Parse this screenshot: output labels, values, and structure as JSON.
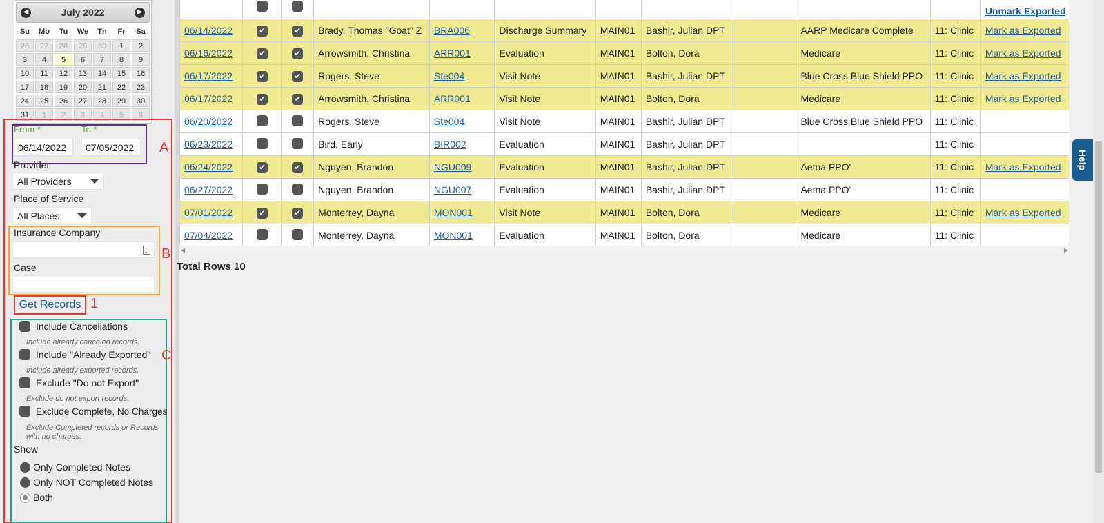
{
  "calendar": {
    "title": "July 2022",
    "prev_icon": "chevron-left-icon",
    "next_icon": "chevron-right-icon",
    "weekdays": [
      "Su",
      "Mo",
      "Tu",
      "We",
      "Th",
      "Fr",
      "Sa"
    ],
    "days": [
      {
        "d": "26",
        "m": true
      },
      {
        "d": "27",
        "m": true
      },
      {
        "d": "28",
        "m": true
      },
      {
        "d": "29",
        "m": true
      },
      {
        "d": "30",
        "m": true
      },
      {
        "d": "1",
        "m": false
      },
      {
        "d": "2",
        "m": false
      },
      {
        "d": "3",
        "m": false
      },
      {
        "d": "4",
        "m": false
      },
      {
        "d": "5",
        "m": false,
        "today": true
      },
      {
        "d": "6",
        "m": false
      },
      {
        "d": "7",
        "m": false
      },
      {
        "d": "8",
        "m": false
      },
      {
        "d": "9",
        "m": false
      },
      {
        "d": "10",
        "m": false
      },
      {
        "d": "11",
        "m": false
      },
      {
        "d": "12",
        "m": false
      },
      {
        "d": "13",
        "m": false
      },
      {
        "d": "14",
        "m": false
      },
      {
        "d": "15",
        "m": false
      },
      {
        "d": "16",
        "m": false
      },
      {
        "d": "17",
        "m": false
      },
      {
        "d": "18",
        "m": false
      },
      {
        "d": "19",
        "m": false
      },
      {
        "d": "20",
        "m": false
      },
      {
        "d": "21",
        "m": false
      },
      {
        "d": "22",
        "m": false
      },
      {
        "d": "23",
        "m": false
      },
      {
        "d": "24",
        "m": false
      },
      {
        "d": "25",
        "m": false
      },
      {
        "d": "26",
        "m": false
      },
      {
        "d": "27",
        "m": false
      },
      {
        "d": "28",
        "m": false
      },
      {
        "d": "29",
        "m": false
      },
      {
        "d": "30",
        "m": false
      },
      {
        "d": "31",
        "m": false
      },
      {
        "d": "1",
        "m": true
      },
      {
        "d": "2",
        "m": true
      },
      {
        "d": "3",
        "m": true
      },
      {
        "d": "4",
        "m": true
      },
      {
        "d": "5",
        "m": true
      },
      {
        "d": "6",
        "m": true
      }
    ]
  },
  "filters": {
    "from_label": "From *",
    "to_label": "To *",
    "from_value": "06/14/2022",
    "to_value": "07/05/2022",
    "provider_label": "Provider",
    "provider_value": "All Providers",
    "place_label": "Place of Service",
    "place_value": "All Places",
    "insurance_label": "Insurance Company",
    "insurance_value": "",
    "case_label": "Case",
    "case_value": "",
    "get_records": "Get Records"
  },
  "annotations": {
    "a": "A",
    "b": "B",
    "c": "C",
    "one": "1"
  },
  "annotation_colors": {
    "red": "#e53935",
    "purple": "#5b2c8c",
    "orange": "#f5a623",
    "teal": "#1aa88a"
  },
  "options": {
    "include_cancellations": {
      "label": "Include Cancellations",
      "help": "Include already canceled records."
    },
    "include_exported": {
      "label": "Include \"Already Exported\"",
      "help": "Include already exported records."
    },
    "exclude_do_not_export": {
      "label": "Exclude \"Do not Export\"",
      "help": "Exclude do not export records."
    },
    "exclude_complete": {
      "label": "Exclude Complete, No Charges",
      "help": "Exclude Completed records or Records with no charges."
    },
    "show_label": "Show",
    "show_options": [
      "Only Completed Notes",
      "Only NOT Completed Notes",
      "Both"
    ],
    "show_selected": "Both"
  },
  "table": {
    "header_action": "Unmark Exported",
    "rows": [
      {
        "date": "06/14/2022",
        "c1": true,
        "c2": true,
        "patient": "Brady, Thomas \"Goat\" Z",
        "id": "BRA006",
        "type": "Discharge Summary",
        "loc": "MAIN01",
        "provider": "Bashir, Julian DPT",
        "extra": "",
        "ins": "AARP Medicare Complete",
        "pos": "11: Clinic",
        "action": "Mark as Exported",
        "hl": true
      },
      {
        "date": "06/16/2022",
        "c1": true,
        "c2": true,
        "patient": "Arrowsmith, Christina",
        "id": "ARR001",
        "type": "Evaluation",
        "loc": "MAIN01",
        "provider": "Bolton, Dora",
        "extra": "",
        "ins": "Medicare",
        "pos": "11: Clinic",
        "action": "Mark as Exported",
        "hl": true
      },
      {
        "date": "06/17/2022",
        "c1": true,
        "c2": true,
        "patient": "Rogers, Steve",
        "id": "Ste004",
        "type": "Visit Note",
        "loc": "MAIN01",
        "provider": "Bashir, Julian DPT",
        "extra": "",
        "ins": "Blue Cross Blue Shield PPO",
        "pos": "11: Clinic",
        "action": "Mark as Exported",
        "hl": true
      },
      {
        "date": "06/17/2022",
        "c1": true,
        "c2": true,
        "patient": "Arrowsmith, Christina",
        "id": "ARR001",
        "type": "Visit Note",
        "loc": "MAIN01",
        "provider": "Bolton, Dora",
        "extra": "",
        "ins": "Medicare",
        "pos": "11: Clinic",
        "action": "Mark as Exported",
        "hl": true
      },
      {
        "date": "06/20/2022",
        "c1": false,
        "c2": false,
        "patient": "Rogers, Steve",
        "id": "Ste004",
        "type": "Visit Note",
        "loc": "MAIN01",
        "provider": "Bashir, Julian DPT",
        "extra": "",
        "ins": "Blue Cross Blue Shield PPO",
        "pos": "11: Clinic",
        "action": "",
        "hl": false
      },
      {
        "date": "06/23/2022",
        "c1": false,
        "c2": false,
        "patient": "Bird, Early",
        "id": "BIR002",
        "type": "Evaluation",
        "loc": "MAIN01",
        "provider": "Bashir, Julian DPT",
        "extra": "",
        "ins": "",
        "pos": "11: Clinic",
        "action": "",
        "hl": false
      },
      {
        "date": "06/24/2022",
        "c1": true,
        "c2": true,
        "patient": "Nguyen, Brandon",
        "id": "NGU009",
        "type": "Evaluation",
        "loc": "MAIN01",
        "provider": "Bashir, Julian DPT",
        "extra": "",
        "ins": "Aetna PPO'",
        "pos": "11: Clinic",
        "action": "Mark as Exported",
        "hl": true
      },
      {
        "date": "06/27/2022",
        "c1": false,
        "c2": false,
        "patient": "Nguyen, Brandon",
        "id": "NGU007",
        "type": "Evaluation",
        "loc": "MAIN01",
        "provider": "Bashir, Julian DPT",
        "extra": "",
        "ins": "Aetna PPO'",
        "pos": "11: Clinic",
        "action": "",
        "hl": false
      },
      {
        "date": "07/01/2022",
        "c1": true,
        "c2": true,
        "patient": "Monterrey, Dayna",
        "id": "MON001",
        "type": "Visit Note",
        "loc": "MAIN01",
        "provider": "Bolton, Dora",
        "extra": "",
        "ins": "Medicare",
        "pos": "11: Clinic",
        "action": "Mark as Exported",
        "hl": true
      },
      {
        "date": "07/04/2022",
        "c1": false,
        "c2": false,
        "patient": "Monterrey, Dayna",
        "id": "MON001",
        "type": "Evaluation",
        "loc": "MAIN01",
        "provider": "Bolton, Dora",
        "extra": "",
        "ins": "Medicare",
        "pos": "11: Clinic",
        "action": "",
        "hl": false
      }
    ],
    "total_label": "Total Rows 10"
  },
  "help_tab": "Help"
}
